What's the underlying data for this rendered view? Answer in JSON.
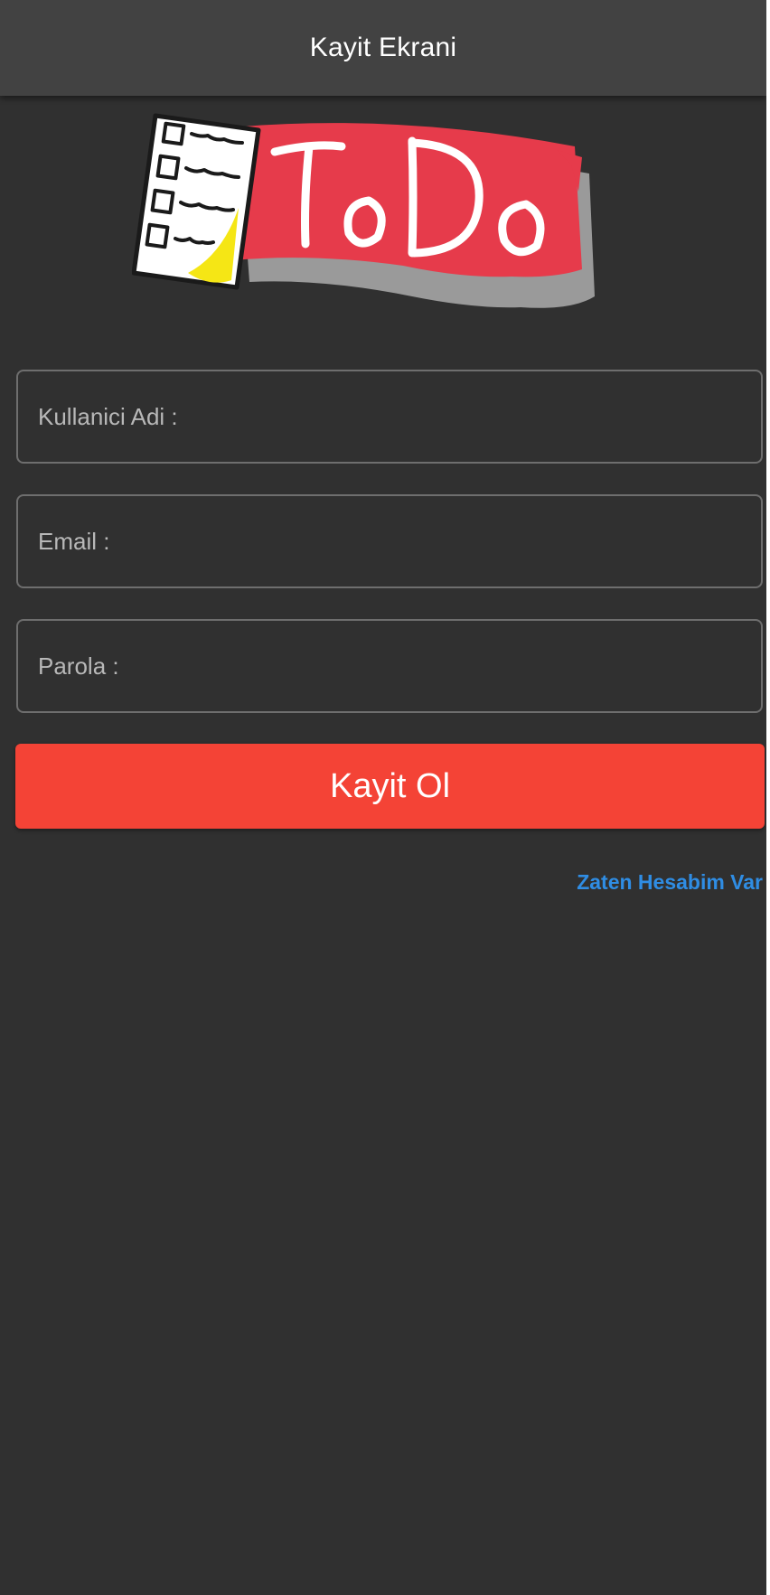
{
  "appbar": {
    "title": "Kayit Ekrani"
  },
  "logo": {
    "text": "ToDo",
    "icon": "checklist-icon",
    "colors": {
      "banner": "#e63b4b",
      "paper": "#ffffff",
      "highlight": "#f5e615"
    }
  },
  "form": {
    "username": {
      "placeholder": "Kullanici Adi :",
      "value": ""
    },
    "email": {
      "placeholder": "Email :",
      "value": ""
    },
    "password": {
      "placeholder": "Parola :",
      "value": ""
    },
    "submit_label": "Kayit Ol",
    "login_link": "Zaten Hesabim Var"
  },
  "colors": {
    "background": "#303030",
    "appbar": "#424242",
    "primary": "#f44336",
    "link": "#2f8de4"
  }
}
